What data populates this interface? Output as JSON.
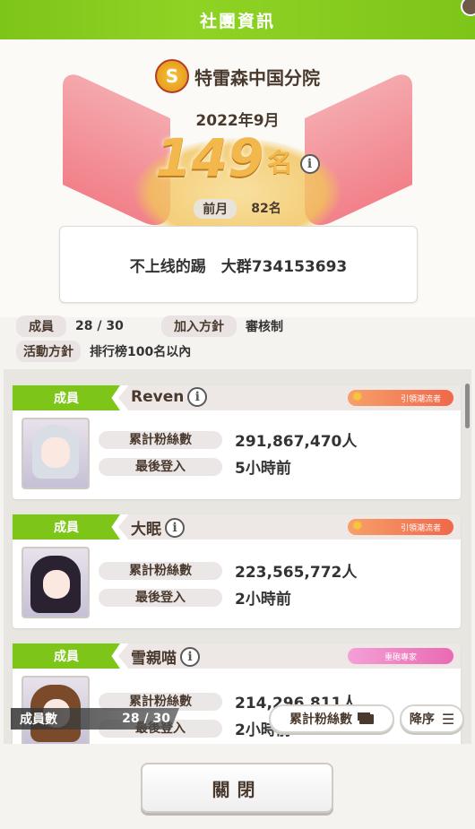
{
  "header": {
    "title": "社團資訊"
  },
  "club": {
    "name": "特雷森中国分院",
    "month": "2022年9月",
    "rank": "149",
    "rank_unit": "名",
    "prev_label": "前月",
    "prev_value": "82名",
    "motto": "不上线的踢　大群734153693",
    "members_label": "成員",
    "members_value": "28 / 30",
    "join_label": "加入方針",
    "join_value": "審核制",
    "activity_label": "活動方針",
    "activity_value": "排行榜100名以內"
  },
  "members": [
    {
      "role": "成員",
      "name": "Reven",
      "badge": "引領潮流者",
      "fans_label": "累計粉絲數",
      "fans": "291,867,470人",
      "login_label": "最後登入",
      "login": "5小時前"
    },
    {
      "role": "成員",
      "name": "大眠",
      "badge": "引領潮流者",
      "fans_label": "累計粉絲數",
      "fans": "223,565,772人",
      "login_label": "最後登入",
      "login": "2小時前"
    },
    {
      "role": "成員",
      "name": "雪親喵",
      "badge": "重砲專家",
      "fans_label": "累計粉絲數",
      "fans": "214,296,811人",
      "login_label": "最後登入",
      "login": "2小時前"
    }
  ],
  "footer": {
    "count_label": "成員數",
    "count_value": "28 / 30",
    "sort_key": "累計粉絲數",
    "sort_order": "降序",
    "close": "關閉"
  }
}
